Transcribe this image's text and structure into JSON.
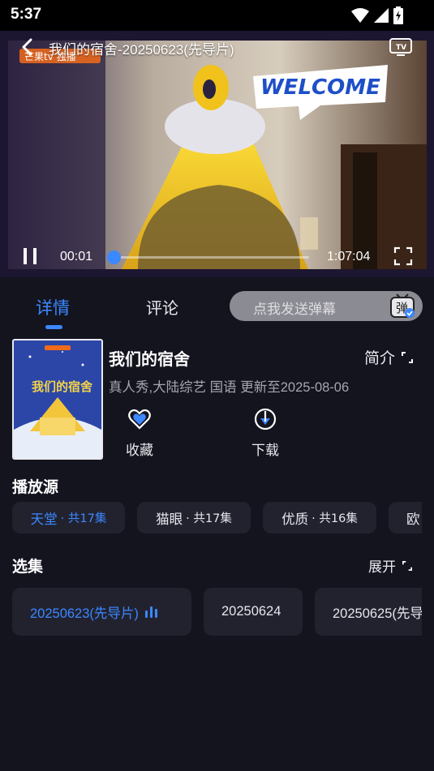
{
  "status_bar": {
    "time": "5:37"
  },
  "player": {
    "title": "我们的宿舍-20250623(先导片)",
    "current_time": "00:01",
    "total_time": "1:07:04",
    "progress": 0.03,
    "overlay_logo": "芒果tv 独播",
    "overlay_banner": "WELCOME"
  },
  "tabs": [
    {
      "label": "详情",
      "active": true
    },
    {
      "label": "评论",
      "active": false
    }
  ],
  "danmaku": {
    "placeholder": "点我发送弹幕",
    "icon": "danmaku-toggle-icon",
    "icon_text": "弹"
  },
  "show": {
    "title": "我们的宿舍",
    "synopsis_label": "简介",
    "meta": "真人秀,大陆综艺 国语 更新至2025-08-06",
    "poster_text": "我们的宿舍"
  },
  "actions": [
    {
      "label": "收藏",
      "icon": "heart-icon"
    },
    {
      "label": "下载",
      "icon": "download-icon"
    }
  ],
  "sources": {
    "title": "播放源",
    "items": [
      {
        "name": "天堂",
        "count": "· 共17集",
        "active": true
      },
      {
        "name": "猫眼",
        "count": "· 共17集",
        "active": false
      },
      {
        "name": "优质",
        "count": "· 共16集",
        "active": false
      },
      {
        "name": "欧",
        "count": "",
        "active": false
      }
    ]
  },
  "episodes": {
    "title": "选集",
    "expand_label": "展开",
    "items": [
      {
        "label": "20250623(先导片)",
        "active": true
      },
      {
        "label": "20250624",
        "active": false
      },
      {
        "label": "20250625(先导",
        "active": false
      }
    ]
  },
  "colors": {
    "accent": "#3b88ff",
    "background": "#14141f",
    "chip": "#22222f"
  }
}
